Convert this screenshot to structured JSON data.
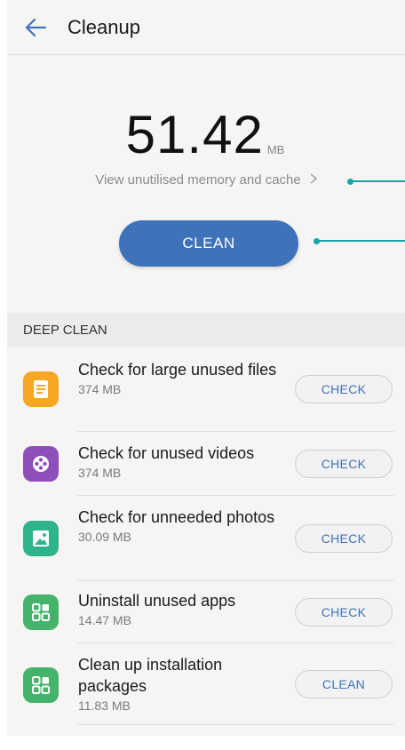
{
  "header": {
    "back_icon": "arrow-left-icon",
    "title": "Cleanup"
  },
  "summary": {
    "size_value": "51.42",
    "size_unit": "MB",
    "view_link": "View unutilised memory and cache",
    "clean_button": "CLEAN"
  },
  "deep_clean": {
    "section_title": "DEEP CLEAN",
    "items": [
      {
        "icon": "document-icon",
        "icon_color": "#f5a623",
        "title": "Check for large unused files",
        "size": "374 MB",
        "button": "CHECK"
      },
      {
        "icon": "film-reel-icon",
        "icon_color": "#8e4fb8",
        "title": "Check for unused videos",
        "size": "374 MB",
        "button": "CHECK"
      },
      {
        "icon": "image-icon",
        "icon_color": "#2fb38a",
        "title": "Check for unneeded photos",
        "size": "30.09 MB",
        "button": "CHECK"
      },
      {
        "icon": "apps-grid-icon",
        "icon_color": "#45b36b",
        "title": "Uninstall unused apps",
        "size": "14.47 MB",
        "button": "CHECK"
      },
      {
        "icon": "package-grid-icon",
        "icon_color": "#45b36b",
        "title": "Clean up installation packages",
        "size": "11.83 MB",
        "button": "CLEAN"
      }
    ]
  },
  "colors": {
    "accent": "#3e73b9",
    "callout": "#14a6a6"
  }
}
